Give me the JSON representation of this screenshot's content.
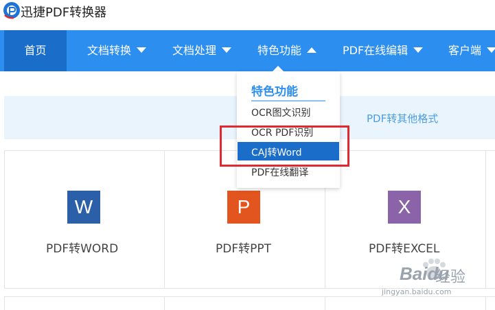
{
  "header": {
    "brand": "迅捷PDF转换器",
    "logo_icon": "pdf-logo-icon"
  },
  "nav": {
    "items": [
      {
        "label": "首页",
        "active": true,
        "caret": ""
      },
      {
        "label": "文档转换",
        "active": false,
        "caret": "down"
      },
      {
        "label": "文档处理",
        "active": false,
        "caret": "down"
      },
      {
        "label": "特色功能",
        "active": false,
        "caret": "up"
      },
      {
        "label": "PDF在线编辑",
        "active": false,
        "caret": "down"
      },
      {
        "label": "客户端",
        "active": false,
        "caret": "down"
      }
    ]
  },
  "banner": {
    "text": "PDF转其他格式"
  },
  "dropdown": {
    "title": "特色功能",
    "items": [
      {
        "label": "OCR图文识别"
      },
      {
        "label": "OCR PDF识别"
      },
      {
        "label": "CAJ转Word",
        "selected": true
      },
      {
        "label": "PDF在线翻译"
      }
    ]
  },
  "tools": [
    {
      "icon_letter": "W",
      "icon_name": "word-file-icon",
      "color": "#2b5fa8",
      "label": "PDF转WORD"
    },
    {
      "icon_letter": "P",
      "icon_name": "ppt-file-icon",
      "color": "#e2551e",
      "label": "PDF转PPT"
    },
    {
      "icon_letter": "X",
      "icon_name": "excel-file-icon",
      "color": "#8a63a8",
      "label": "PDF转EXCEL"
    }
  ],
  "watermark": {
    "brand": "Baidu",
    "suffix": "经验",
    "url": "jingyan.baidu.com"
  },
  "colors": {
    "nav_bg": "#2c8ff0",
    "nav_active": "#1a6dc9",
    "highlight": "#e0282e"
  }
}
